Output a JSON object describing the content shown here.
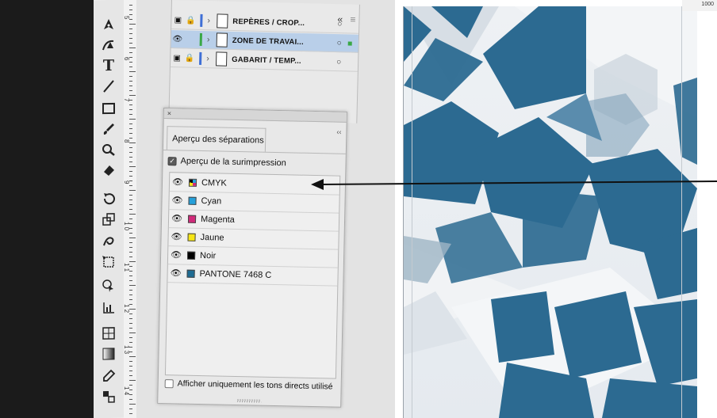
{
  "layers": {
    "collapse_icon": "«",
    "menu_icon": "≡",
    "rows": [
      {
        "name": "REPÈRES / CROP...",
        "color": "#3f6fd6",
        "selected": false,
        "visible": false,
        "locked": true
      },
      {
        "name": "ZONE DE TRAVAI...",
        "color": "#39a845",
        "selected": true,
        "visible": true,
        "locked": false
      },
      {
        "name": "GABARIT / TEMP...",
        "color": "#3f6fd6",
        "selected": false,
        "visible": false,
        "locked": true
      }
    ]
  },
  "separations": {
    "close_icon": "×",
    "collapse_icon": "‹‹",
    "tab_label": "Aperçu des séparations",
    "overprint_label": "Aperçu de la surimpression",
    "overprint_checked": true,
    "inks": [
      {
        "name": "CMYK",
        "swatch": "cmyk"
      },
      {
        "name": "Cyan",
        "swatch": "#25a0da"
      },
      {
        "name": "Magenta",
        "swatch": "#d12a7a"
      },
      {
        "name": "Jaune",
        "swatch": "#f6e515"
      },
      {
        "name": "Noir",
        "swatch": "#000000"
      },
      {
        "name": "PANTONE 7468 C",
        "swatch": "#1f6c93"
      }
    ],
    "spot_only_label": "Afficher uniquement les tons directs utilisé",
    "spot_only_checked": false
  },
  "ruler": {
    "left_numbers": [
      "5",
      "6",
      "7",
      "8",
      "9",
      "1 0",
      "1 1",
      "1 2",
      "1 3",
      "1 4"
    ],
    "top_right": "1000"
  },
  "colors": {
    "art_blue": "#2c6a91",
    "art_blue_light": "#5a8cad",
    "art_gray": "#c9d3dc"
  }
}
